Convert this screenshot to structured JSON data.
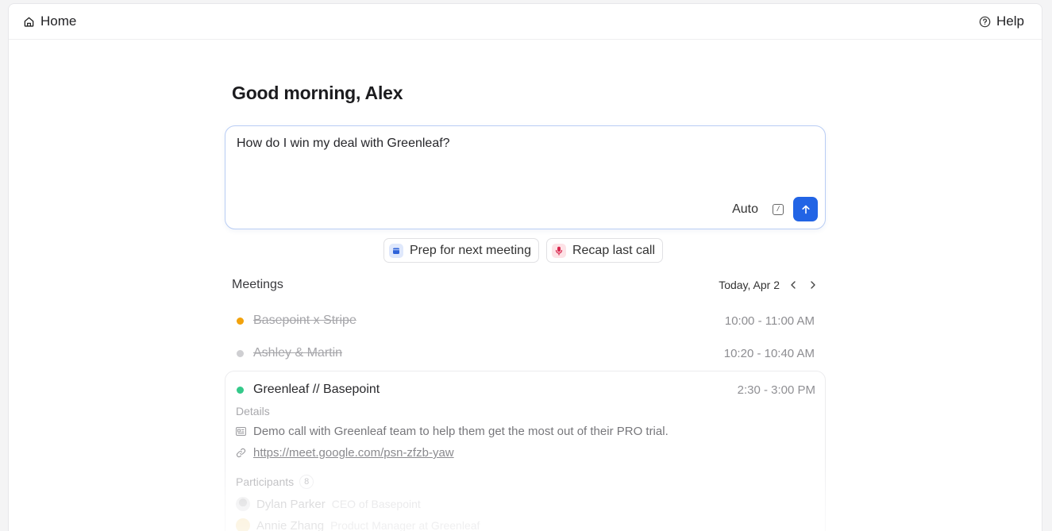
{
  "topbar": {
    "home_label": "Home",
    "help_label": "Help"
  },
  "greeting": "Good morning, Alex",
  "composer": {
    "value": "How do I win my deal with Greenleaf?",
    "mode_label": "Auto",
    "shortcut_key": "/",
    "accent_color": "#2264e5"
  },
  "suggestions": [
    {
      "label": "Prep for next meeting",
      "icon": "calendar-icon"
    },
    {
      "label": "Recap last call",
      "icon": "microphone-icon"
    }
  ],
  "meetings": {
    "title": "Meetings",
    "date_label": "Today, Apr 2",
    "items": [
      {
        "name": "Basepoint x Stripe",
        "time": "10:00 - 11:00 AM",
        "status_color": "#f2a20c",
        "completed": true
      },
      {
        "name": "Ashley & Martin",
        "time": "10:20 - 10:40 AM",
        "status_color": "#cfcfd2",
        "completed": true
      },
      {
        "name": "Greenleaf // Basepoint",
        "time": "2:30 - 3:00 PM",
        "status_color": "#34c98a",
        "completed": false
      }
    ]
  },
  "meeting_detail": {
    "details_label": "Details",
    "description": "Demo call with Greenleaf team to help them get the most out of their PRO trial.",
    "link": "https://meet.google.com/psn-zfzb-yaw",
    "participants_label": "Participants",
    "participants_count": "8",
    "participants": [
      {
        "name": "Dylan Parker",
        "role": "CEO of Basepoint"
      },
      {
        "name": "Annie Zhang",
        "role": "Product Manager at Greenleaf"
      }
    ]
  }
}
